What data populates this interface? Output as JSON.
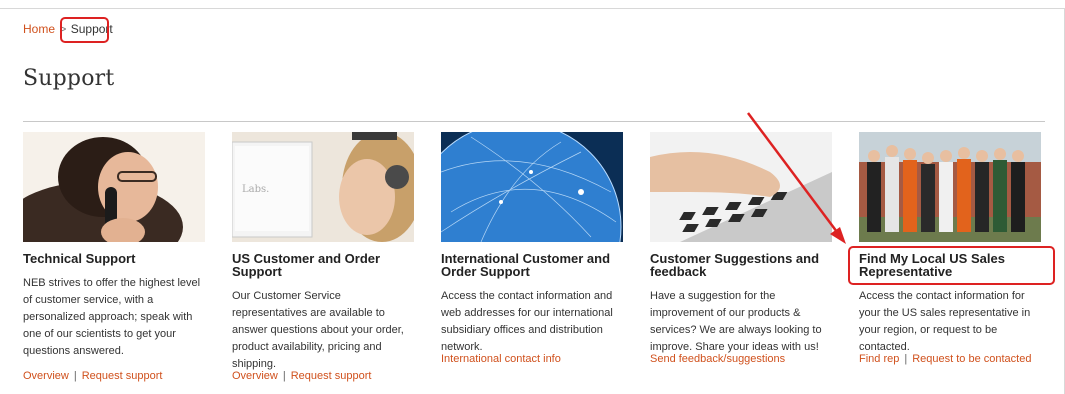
{
  "breadcrumb": {
    "home": "Home",
    "separator": ">",
    "current": "Support"
  },
  "page_title": "Support",
  "cards": [
    {
      "image": "technician-on-phone-photo",
      "title": "Technical Support",
      "description": "NEB strives to offer the highest level of customer service, with a personalized approach; speak with one of our scientists to get your questions answered.",
      "links": [
        "Overview",
        "Request support"
      ]
    },
    {
      "image": "headset-service-rep-photo",
      "title": "US Customer and Order Support",
      "description": "Our Customer Service representatives are available to answer questions about your order, product availability, pricing and shipping.",
      "links": [
        "Overview",
        "Request support"
      ]
    },
    {
      "image": "globe-network-image",
      "title": "International Customer and Order Support",
      "description": "Access the contact information and web addresses for our international subsidiary offices and distribution network.",
      "links": [
        "International contact info"
      ]
    },
    {
      "image": "typing-keyboard-photo",
      "title": "Customer Suggestions and feedback",
      "description": "Have a suggestion for the improvement of our products & services? We are always looking to improve. Share your ideas with us!",
      "links": [
        "Send feedback/suggestions"
      ]
    },
    {
      "image": "sales-team-group-photo",
      "title": "Find My Local US Sales Representative",
      "description": "Access the contact information for your the US sales representative in your region, or request to be contacted.",
      "links": [
        "Find rep",
        "Request to be contacted"
      ]
    }
  ],
  "colors": {
    "link": "#d0511d",
    "highlight": "#dd2222"
  }
}
